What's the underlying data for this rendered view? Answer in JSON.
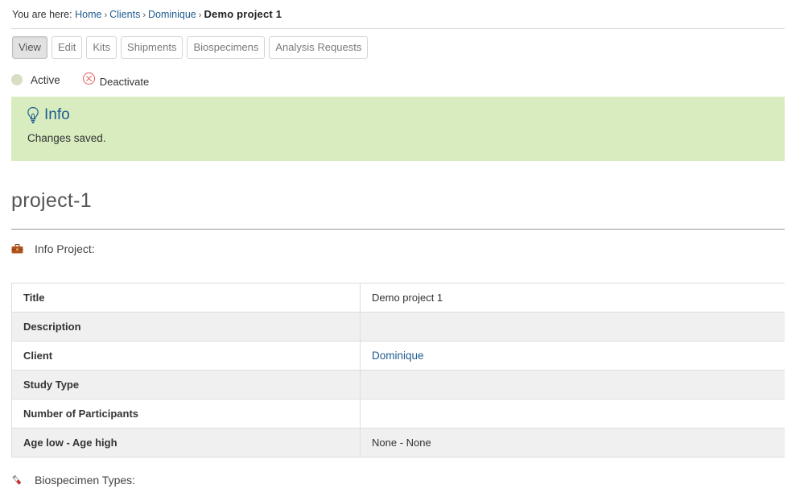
{
  "breadcrumb": {
    "prefix": "You are here:",
    "items": [
      "Home",
      "Clients",
      "Dominique"
    ],
    "separator": "›",
    "current": "Demo project 1"
  },
  "tabs": [
    {
      "label": "View",
      "active": true
    },
    {
      "label": "Edit",
      "active": false
    },
    {
      "label": "Kits",
      "active": false
    },
    {
      "label": "Shipments",
      "active": false
    },
    {
      "label": "Biospecimens",
      "active": false
    },
    {
      "label": "Analysis Requests",
      "active": false
    }
  ],
  "state": {
    "label": "Active",
    "deactivate_label": "Deactivate"
  },
  "message": {
    "title": "Info",
    "text": "Changes saved."
  },
  "page_title": "project-1",
  "info_section": {
    "label": "Info Project:",
    "icon": "briefcase-icon"
  },
  "table": {
    "rows": [
      {
        "key": "Title",
        "value": "Demo project 1"
      },
      {
        "key": "Description",
        "value": ""
      },
      {
        "key": "Client",
        "value": "Dominique",
        "link": true
      },
      {
        "key": "Study Type",
        "value": ""
      },
      {
        "key": "Number of Participants",
        "value": ""
      },
      {
        "key": "Age low - Age high",
        "value": "None - None"
      }
    ]
  },
  "biospecimen_section": {
    "label": "Biospecimen Types:",
    "icon": "test-tube-icon"
  },
  "colors": {
    "link": "#205c90",
    "info_bg": "#d8ecbf",
    "state_dot": "#d6dfc4",
    "deactivate": "#e35a5a"
  }
}
